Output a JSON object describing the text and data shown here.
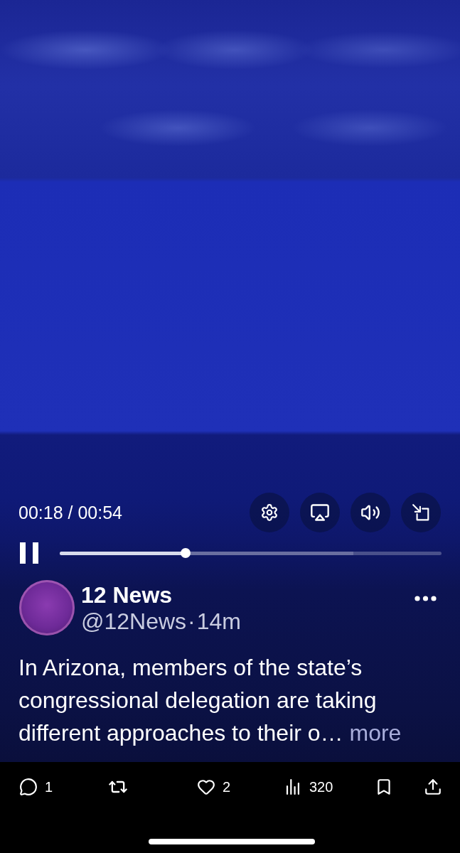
{
  "player": {
    "time": "00:18 / 00:54",
    "muted": false,
    "playing": true,
    "progress": {
      "level": 0.33
    },
    "buffered": {
      "level": 0.77
    }
  },
  "post": {
    "author": {
      "name": "12 News",
      "handle": "@12News",
      "separator": "·",
      "time": "14m"
    },
    "text": "In Arizona, members of the state’s congressional delegation are taking different approaches to their o…",
    "more_link": "more"
  },
  "actions": [
    {
      "kind": "reply",
      "count": "1"
    },
    {
      "kind": "repost"
    },
    {
      "kind": "like",
      "count": "2"
    },
    {
      "kind": "views",
      "count": "320"
    },
    {
      "kind": "bookmark"
    },
    {
      "kind": "share"
    }
  ]
}
